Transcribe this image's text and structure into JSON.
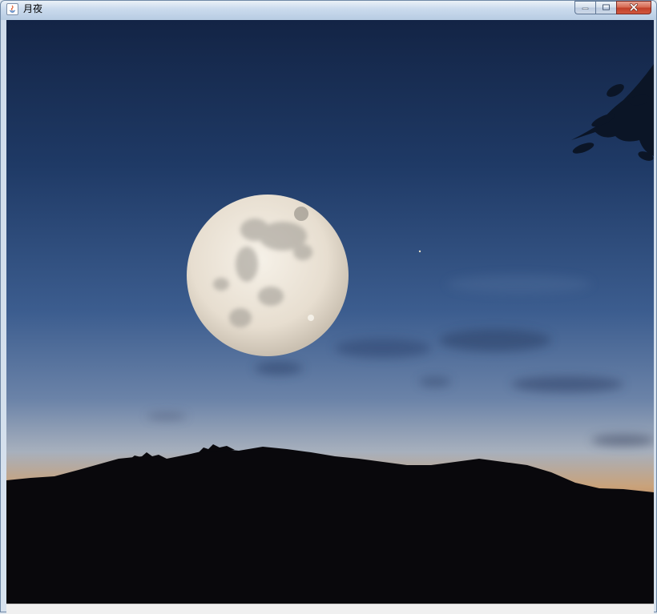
{
  "window": {
    "title": "月夜"
  },
  "icons": {
    "app": "java-icon",
    "minimize": "minimize-icon",
    "maximize": "maximize-icon",
    "close": "close-icon"
  },
  "colors": {
    "sky_top": "#16284a",
    "sky_mid": "#3a5a8c",
    "sky_horizon": "#c79a6a",
    "hills": "#0a090d",
    "moon": "#e9e2d6"
  }
}
